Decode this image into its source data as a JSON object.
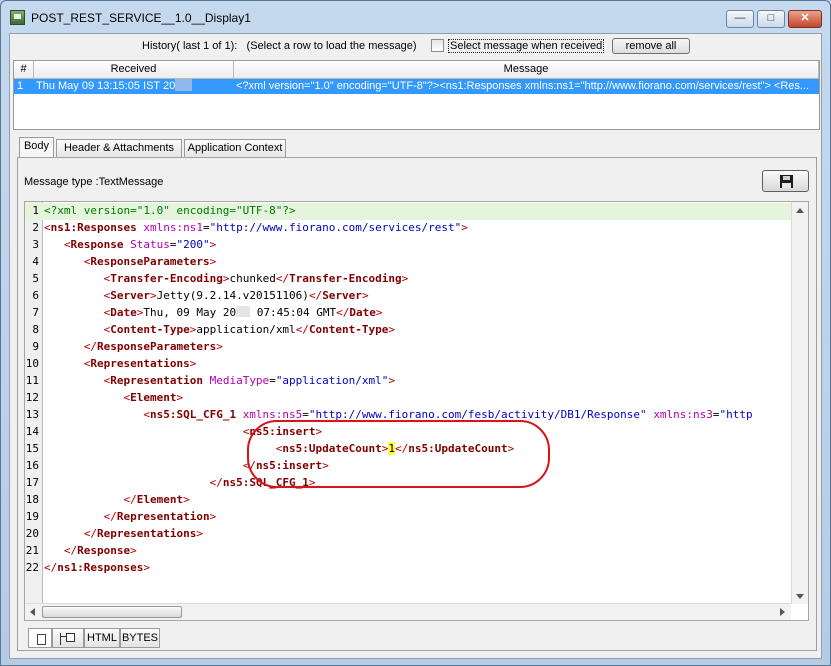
{
  "window": {
    "title": "POST_REST_SERVICE__1.0__Display1",
    "minimize": "—",
    "maximize": "□",
    "close": "✕"
  },
  "history": {
    "label": "History( last 1 of 1):   (Select a row to load the message)",
    "checkbox_label": "Select message when received",
    "checkbox_checked": false,
    "remove_all": "remove all"
  },
  "table": {
    "columns": [
      "#",
      "Received",
      "Message"
    ],
    "rows": [
      {
        "num": "1",
        "received": "Thu May 09 13:15:05 IST 20",
        "message": "<?xml version=\"1.0\" encoding=\"UTF-8\"?><ns1:Responses xmlns:ns1=\"http://www.fiorano.com/services/rest\">    <Res..."
      }
    ]
  },
  "tabs": [
    "Body",
    "Header & Attachments",
    "Application Context"
  ],
  "active_tab": "Body",
  "message_type": "Message type :TextMessage",
  "save_icon": "floppy-disk-icon",
  "editor_lines": [
    "1",
    "2",
    "3",
    "4",
    "5",
    "6",
    "7",
    "8",
    "9",
    "10",
    "11",
    "12",
    "13",
    "14",
    "15",
    "16",
    "17",
    "18",
    "19",
    "20",
    "21",
    "22"
  ],
  "code": {
    "l1": "<?xml version=\"1.0\" encoding=\"UTF-8\"?>",
    "l2_tag": "ns1:Responses",
    "l2_attr": "xmlns:ns1",
    "l2_val": "\"http://www.fiorano.com/services/rest\"",
    "l3_tag": "Response",
    "l3_attr": "Status",
    "l3_val": "\"200\"",
    "l4_tag": "ResponseParameters",
    "l5_tag": "Transfer-Encoding",
    "l5_text": "chunked",
    "l6_tag": "Server",
    "l6_text": "Jetty(9.2.14.v20151106)",
    "l7_tag": "Date",
    "l7_text_a": "Thu, 09 May 20",
    "l7_text_b": " 07:45:04 GMT",
    "l8_tag": "Content-Type",
    "l8_text": "application/xml",
    "l10_tag": "Representations",
    "l11_tag": "Representation",
    "l11_attr": "MediaType",
    "l11_val": "\"application/xml\"",
    "l12_tag": "Element",
    "l13_tag": "ns5:SQL_CFG_1",
    "l13_attr1": "xmlns:ns5",
    "l13_val1": "\"http://www.fiorano.com/fesb/activity/DB1/Response\"",
    "l13_attr2": "xmlns:ns3",
    "l13_val2": "\"http",
    "l14_tag": "ns5:insert",
    "l15_tag": "ns5:UpdateCount",
    "l15_text": "1",
    "l17_tag": "ns5:SQL_CFG_1"
  },
  "bottom_tabs": [
    "HTML",
    "BYTES"
  ],
  "bottom_icons": [
    "document-icon",
    "tree-view-icon"
  ]
}
